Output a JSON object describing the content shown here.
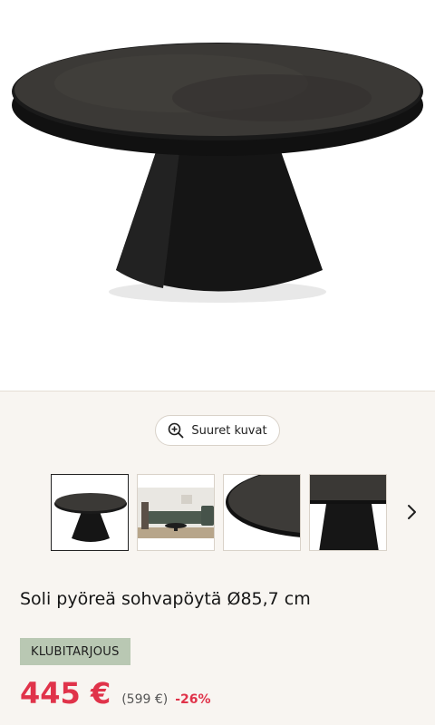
{
  "zoom": {
    "label": "Suuret kuvat",
    "icon": "zoom-in-icon"
  },
  "gallery": {
    "next_icon": "chevron-right-icon",
    "thumbnails": [
      "table-front",
      "room-scene",
      "tabletop-edge-closeup",
      "base-closeup"
    ],
    "selected_index": 0
  },
  "product": {
    "title": "Soli pyöreä sohvapöytä Ø85,7 cm",
    "badge": "KLUBITARJOUS"
  },
  "price": {
    "current": "445 €",
    "original": "(599 €)",
    "discount": "-26%"
  },
  "colors": {
    "sale_red": "#e0334a",
    "badge_green": "#b9c8b3",
    "background": "#f8f5f1"
  }
}
